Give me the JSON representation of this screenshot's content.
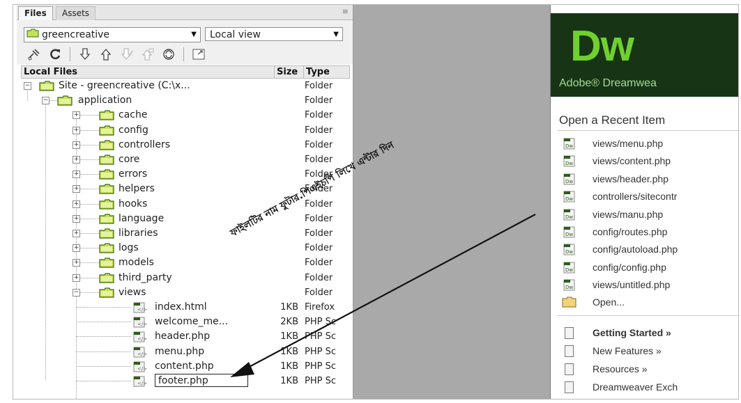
{
  "files_panel": {
    "tabs": [
      "Files",
      "Assets"
    ],
    "menu_icon": "≡",
    "site_select": "greencreative",
    "view_select": "Local view",
    "toolbar_icons": [
      "connect-icon",
      "refresh-icon",
      "get-files-icon",
      "put-files-icon",
      "check-out-icon",
      "check-in-icon",
      "synchronize-icon",
      "expand-icon"
    ],
    "columns": {
      "name": "Local Files",
      "size": "Size",
      "type": "Type"
    },
    "rows": [
      {
        "name": "Site - greencreative (C:\\x...",
        "size": "",
        "type": "Folder"
      },
      {
        "name": "application",
        "size": "",
        "type": "Folder"
      },
      {
        "name": "cache",
        "size": "",
        "type": "Folder"
      },
      {
        "name": "config",
        "size": "",
        "type": "Folder"
      },
      {
        "name": "controllers",
        "size": "",
        "type": "Folder"
      },
      {
        "name": "core",
        "size": "",
        "type": "Folder"
      },
      {
        "name": "errors",
        "size": "",
        "type": "Folder"
      },
      {
        "name": "helpers",
        "size": "",
        "type": "Folder"
      },
      {
        "name": "hooks",
        "size": "",
        "type": "Folder"
      },
      {
        "name": "language",
        "size": "",
        "type": "Folder"
      },
      {
        "name": "libraries",
        "size": "",
        "type": "Folder"
      },
      {
        "name": "logs",
        "size": "",
        "type": "Folder"
      },
      {
        "name": "models",
        "size": "",
        "type": "Folder"
      },
      {
        "name": "third_party",
        "size": "",
        "type": "Folder"
      },
      {
        "name": "views",
        "size": "",
        "type": "Folder"
      },
      {
        "name": "index.html",
        "size": "1KB",
        "type": "Firefox"
      },
      {
        "name": "welcome_me...",
        "size": "2KB",
        "type": "PHP Sc"
      },
      {
        "name": "header.php",
        "size": "1KB",
        "type": "PHP Sc"
      },
      {
        "name": "menu.php",
        "size": "1KB",
        "type": "PHP Sc"
      },
      {
        "name": "content.php",
        "size": "1KB",
        "type": "PHP Sc"
      },
      {
        "name": "footer.php",
        "size": "1KB",
        "type": "PHP Sc"
      }
    ]
  },
  "welcome": {
    "logo": "Dw",
    "product": "Adobe® Dreamwea",
    "recent_title": "Open a Recent Item",
    "recent_items": [
      "views/menu.php",
      "views/content.php",
      "views/header.php",
      "controllers/sitecontr",
      "views/manu.php",
      "config/routes.php",
      "config/autoload.php",
      "config/config.php",
      "views/untitled.php"
    ],
    "open_label": "Open...",
    "links": [
      "Getting Started »",
      "New Features »",
      "Resources »",
      "Dreamweaver Exch"
    ]
  },
  "annotation": {
    "text": "ফাইলটির নাম ফুটার.পিএইচপি লিখে এন্টার দিন",
    "color": "#111111"
  },
  "colors": {
    "folder_fill": "#c7e05a",
    "folder_stroke": "#3b6a11",
    "dw_green": "#70d02e",
    "dw_dark": "#173515",
    "gap_gray": "#a9a9a9"
  }
}
